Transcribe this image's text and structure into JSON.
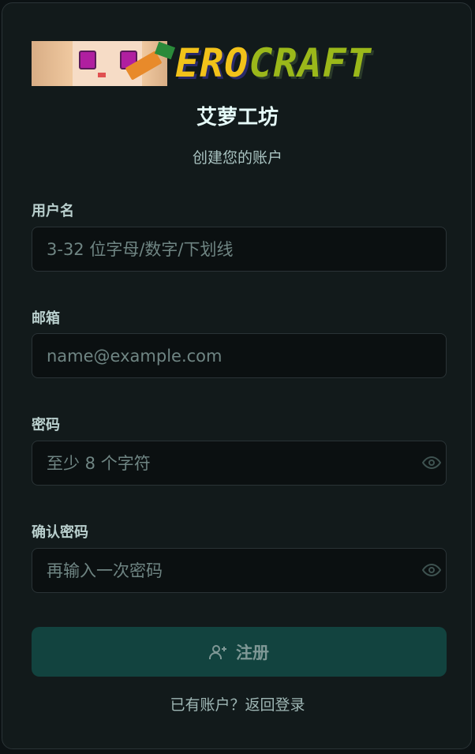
{
  "brand": {
    "logo_part1": "ERO",
    "logo_part2": "CRAFT",
    "title": "艾萝工坊",
    "subtitle": "创建您的账户"
  },
  "form": {
    "username": {
      "label": "用户名",
      "placeholder": "3-32 位字母/数字/下划线",
      "value": ""
    },
    "email": {
      "label": "邮箱",
      "placeholder": "name@example.com",
      "value": ""
    },
    "password": {
      "label": "密码",
      "placeholder": "至少 8 个字符",
      "value": ""
    },
    "confirm_password": {
      "label": "确认密码",
      "placeholder": "再输入一次密码",
      "value": ""
    },
    "submit_label": "注册"
  },
  "footer": {
    "text": "已有账户？",
    "link": "返回登录"
  },
  "colors": {
    "background": "#121a1b",
    "accent": "#12433f",
    "title": "#e6fbf9"
  },
  "icons": {
    "password_toggle": "eye-icon",
    "confirm_toggle": "eye-icon",
    "submit": "user-plus-icon"
  }
}
